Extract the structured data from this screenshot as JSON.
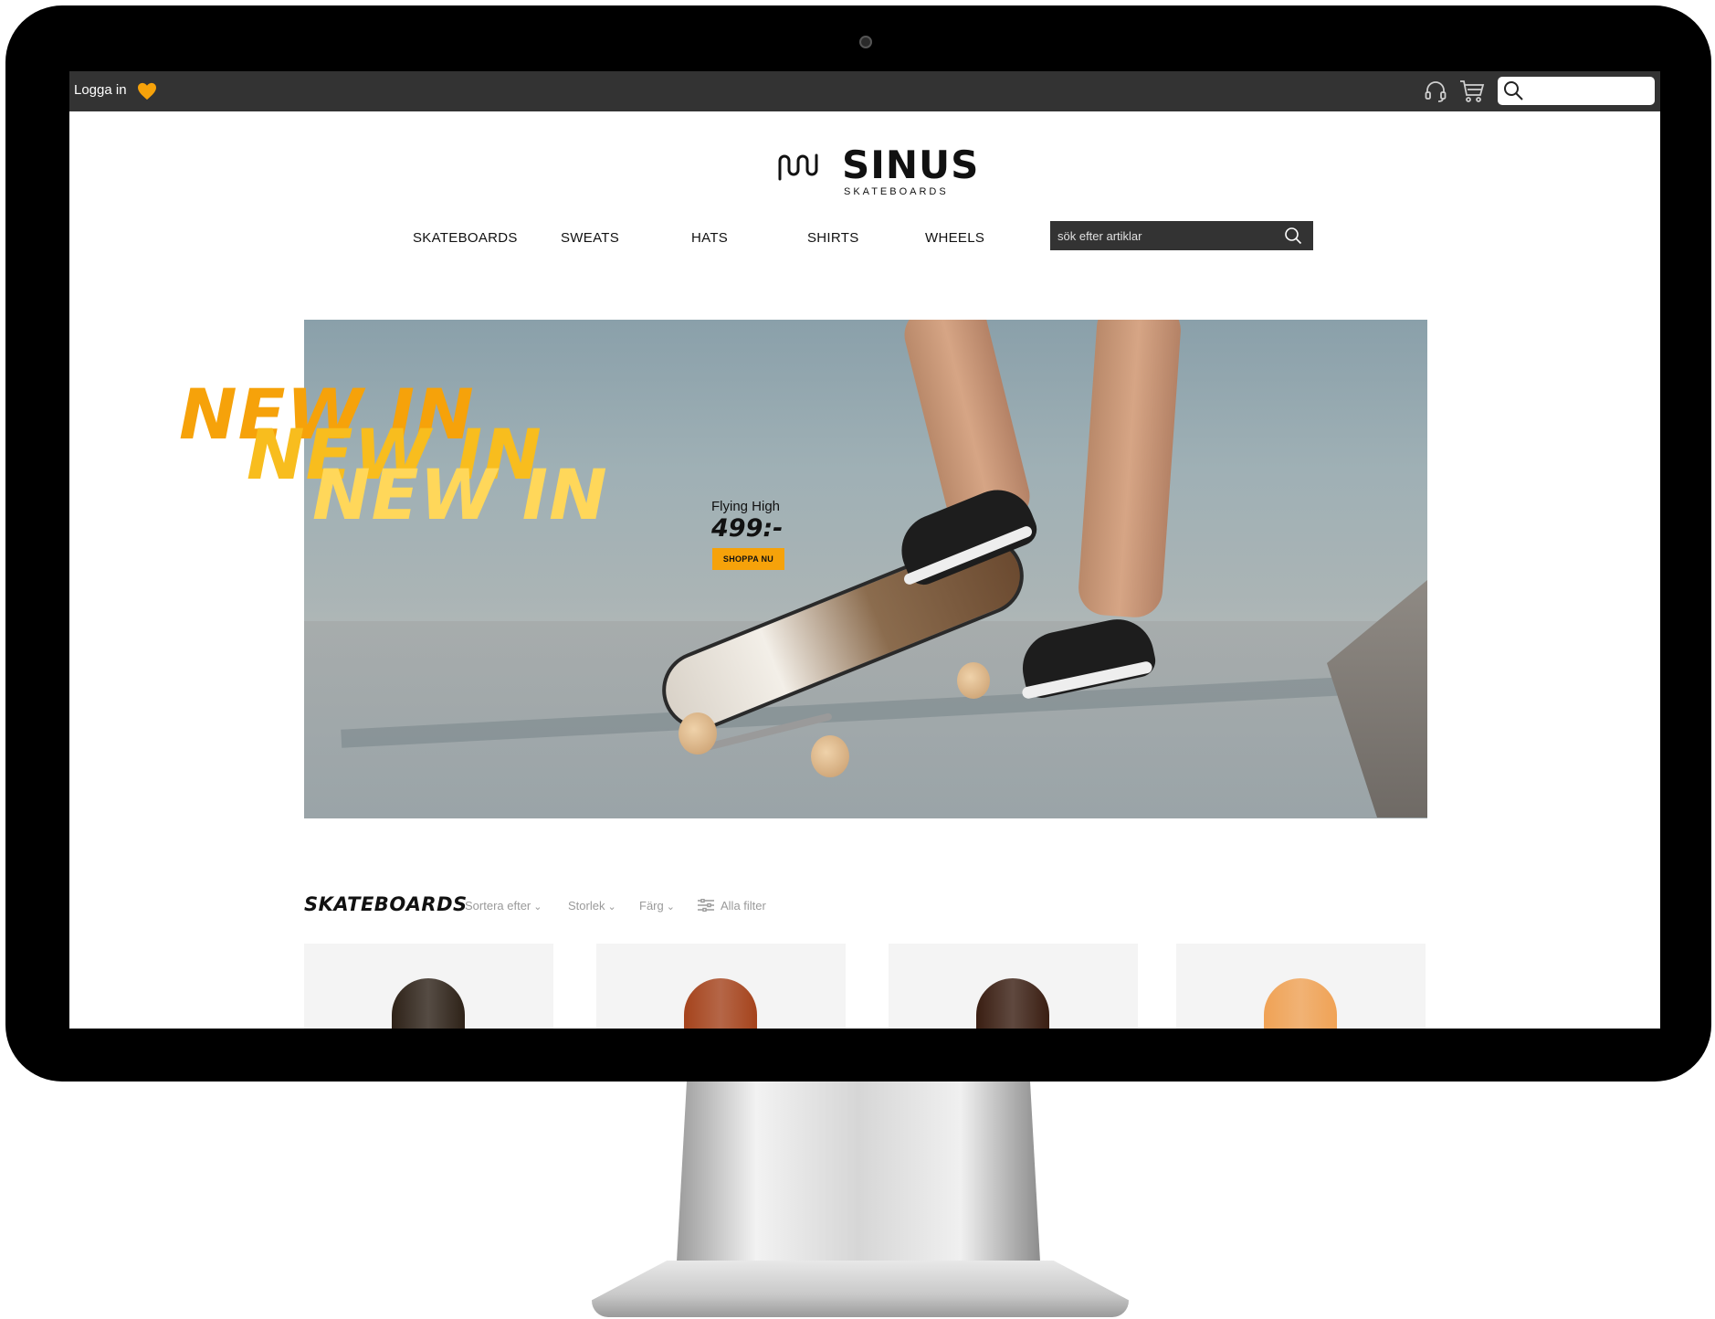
{
  "topbar": {
    "login_label": "Logga in",
    "icons": [
      "heart-icon",
      "headset-icon",
      "cart-icon",
      "search-icon"
    ],
    "search_value": ""
  },
  "brand": {
    "name": "SINUS",
    "tagline": "SKATEBOARDS"
  },
  "nav": {
    "items": [
      "SKATEBOARDS",
      "SWEATS",
      "HATS",
      "SHIRTS",
      "WHEELS"
    ],
    "search_placeholder": "sök efter artiklar"
  },
  "hero": {
    "headline": "NEW IN",
    "product_name": "Flying High",
    "price": "499:-",
    "cta_label": "SHOPPA NU"
  },
  "products": {
    "section_title": "SKATEBOARDS",
    "filters": [
      "Sortera efter",
      "Storlek",
      "Färg"
    ],
    "all_filters_label": "Alla filter",
    "cards": [
      {
        "deck_color": "#2e2218"
      },
      {
        "deck_color": "#a5431c"
      },
      {
        "deck_color": "#3a1e12"
      },
      {
        "deck_color": "#f0a255"
      }
    ]
  },
  "colors": {
    "accent": "#f6a20a",
    "topbar": "#333333"
  }
}
